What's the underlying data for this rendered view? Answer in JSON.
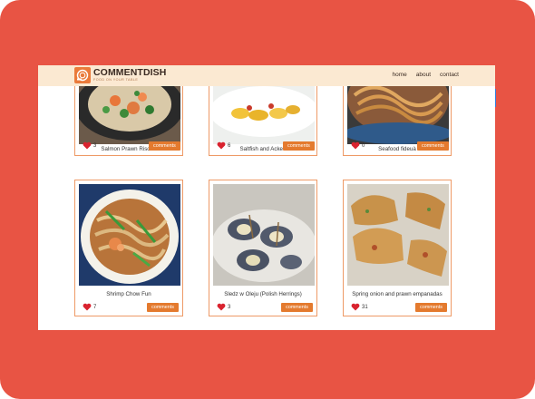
{
  "header": {
    "brand": "COMMENTDISH",
    "tagline": "FOOD ON YOUR TABLE",
    "nav": [
      "home",
      "about",
      "contact"
    ]
  },
  "colors": {
    "frame": "#e85444",
    "navbar": "#fbe9d2",
    "accent": "#e47a2e",
    "card_border": "#ee9a66",
    "heart": "#d9232f"
  },
  "dishes": [
    {
      "title": "Salmon Prawn Risotto",
      "likes": "3",
      "button": "comments"
    },
    {
      "title": "Saltfish and Ackee",
      "likes": "6",
      "button": "comments"
    },
    {
      "title": "Seafood fideuà",
      "likes": "0",
      "button": "comments"
    },
    {
      "title": "Shrimp Chow Fun",
      "likes": "7",
      "button": "comments"
    },
    {
      "title": "Sledz w Oleju (Polish Herrings)",
      "likes": "3",
      "button": "comments"
    },
    {
      "title": "Spring onion and prawn empanadas",
      "likes": "31",
      "button": "comments"
    }
  ]
}
